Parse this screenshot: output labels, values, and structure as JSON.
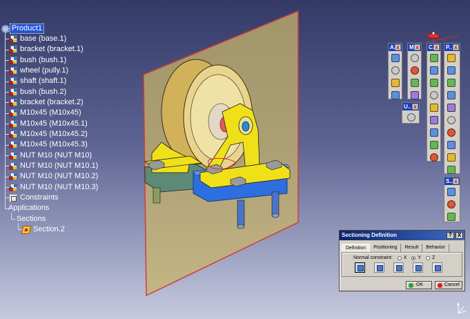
{
  "tree": {
    "root": "Product1",
    "parts": [
      "base (base.1)",
      "bracket (bracket.1)",
      "bush (bush.1)",
      "wheel (pully.1)",
      "shaft (shaft.1)",
      "bush (bush.2)",
      "bracket (bracket.2)",
      "M10x45 (M10x45)",
      "M10x45 (M10x45.1)",
      "M10x45 (M10x45.2)",
      "M10x45 (M10x45.3)",
      "NUT M10 (NUT M10)",
      "NUT M10 (NUT M10.1)",
      "NUT M10 (NUT M10.2)",
      "NUT M10 (NUT M10.3)"
    ],
    "constraints": "Constraints",
    "applications": "Applications",
    "sections": "Sections",
    "section": "Section.2"
  },
  "toolbars": {
    "t1": {
      "title": "A..",
      "close": "x"
    },
    "t2": {
      "title": "M..",
      "close": "x"
    },
    "t3": {
      "title": "C..",
      "close": "x"
    },
    "t4": {
      "title": "P..",
      "close": "x"
    },
    "t5": {
      "title": "U..",
      "close": "x"
    },
    "t6": {
      "title": "S..",
      "close": "x"
    }
  },
  "dialog": {
    "title": "Sectioning Definition",
    "help": "?",
    "close": "X",
    "tabs": [
      "Definition",
      "Positioning",
      "Result",
      "Behavior"
    ],
    "normal_constraint_label": "Normal constraint:",
    "axes": [
      "X",
      "Y",
      "Z"
    ],
    "selected_axis": "Y",
    "ok": "OK",
    "cancel": "Cancel"
  },
  "colors": {
    "tree_selection": "#2456d6",
    "section_plane": "#c7b36a",
    "plane_border": "#d23a3a",
    "part_yellow": "#f0e01a",
    "base_blue": "#2d6fe0"
  }
}
